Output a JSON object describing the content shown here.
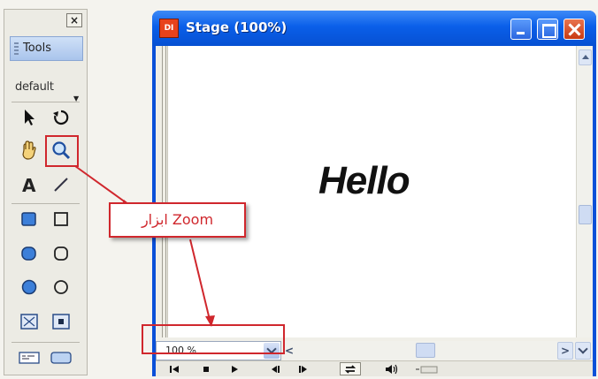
{
  "tools_panel": {
    "close_label": "×",
    "title": "Tools",
    "default_label": "default"
  },
  "stage_window": {
    "icon_text": "DI",
    "title": "Stage (100%)",
    "canvas_text": "Hello"
  },
  "zoom_select": {
    "value": "100 %"
  },
  "callout": {
    "label": "ابزار Zoom"
  },
  "colors": {
    "highlight": "#d0272d",
    "titlebar": "#0a5fe9"
  }
}
